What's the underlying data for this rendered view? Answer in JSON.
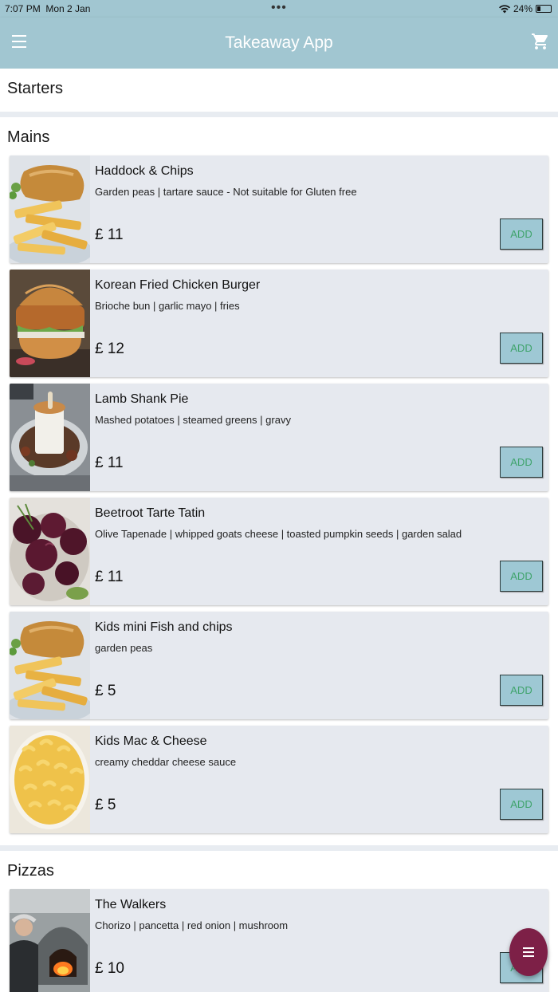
{
  "status_bar": {
    "time": "7:07 PM",
    "date": "Mon 2 Jan",
    "dots": "•••",
    "battery": "24%",
    "battery_level": 0.24
  },
  "app_bar": {
    "title": "Takeaway App",
    "menu_icon": "hamburger-menu-icon",
    "cart_icon": "cart-icon"
  },
  "sections": {
    "starters": {
      "label": "Starters"
    },
    "mains": {
      "label": "Mains"
    },
    "pizzas": {
      "label": "Pizzas"
    }
  },
  "items": [
    {
      "name": "Haddock & Chips",
      "desc": "Garden peas | tartare sauce - Not suitable for Gluten free",
      "price": "£ 11",
      "add": "ADD",
      "image": "fish-and-chips-photo"
    },
    {
      "name": "Korean Fried Chicken Burger",
      "desc": "Brioche bun | garlic mayo | fries",
      "price": "£ 12",
      "add": "ADD",
      "image": "chicken-burger-photo"
    },
    {
      "name": "Lamb Shank Pie",
      "desc": "Mashed potatoes | steamed greens | gravy",
      "price": "£ 11",
      "add": "ADD",
      "image": "lamb-pie-photo"
    },
    {
      "name": "Beetroot Tarte Tatin",
      "desc": "Olive Tapenade | whipped goats cheese | toasted pumpkin seeds | garden salad",
      "price": "£ 11",
      "add": "ADD",
      "image": "beetroot-tart-photo"
    },
    {
      "name": "Kids mini Fish and chips",
      "desc": "garden peas",
      "price": "£ 5",
      "add": "ADD",
      "image": "fish-and-chips-photo"
    },
    {
      "name": "Kids Mac & Cheese",
      "desc": "creamy cheddar cheese sauce",
      "price": "£ 5",
      "add": "ADD",
      "image": "mac-and-cheese-photo"
    },
    {
      "name": "The Walkers",
      "desc": "Chorizo | pancetta | red onion | mushroom",
      "price": "£ 10",
      "add": "ADD",
      "image": "pizza-oven-photo"
    }
  ],
  "fab": {
    "icon": "list-menu-icon"
  },
  "colors": {
    "app_bar": "#a1c6d1",
    "card": "#e6e9ef",
    "add_button": "#9ec8d4",
    "add_text": "#3fa36b",
    "fab": "#7d2047"
  }
}
